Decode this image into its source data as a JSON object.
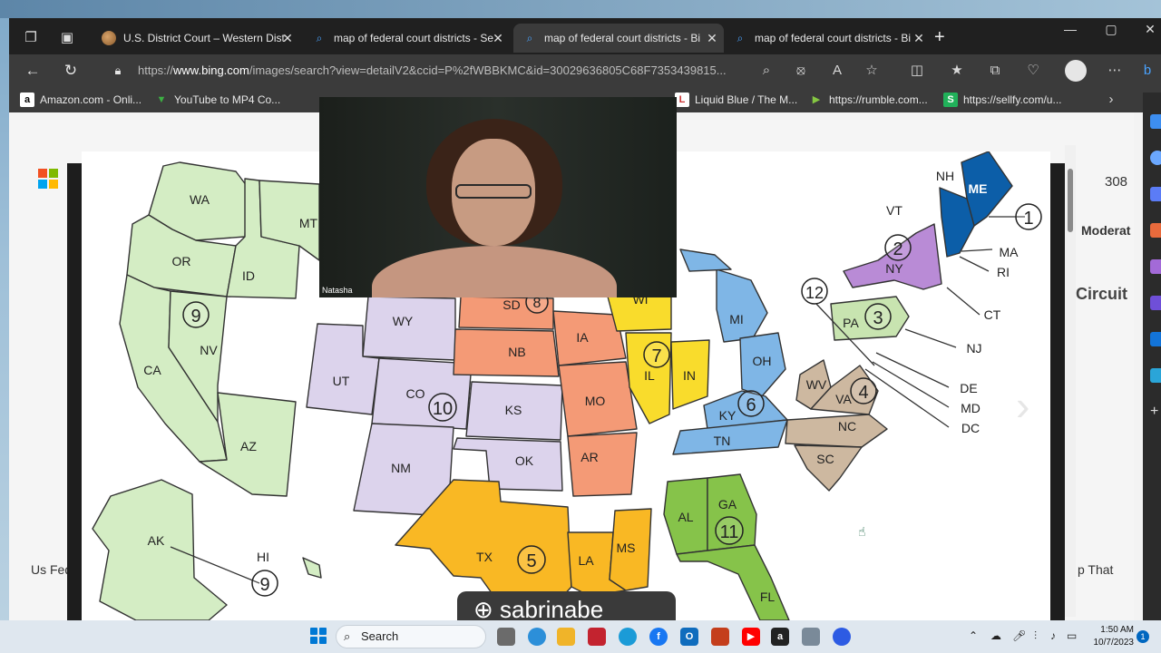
{
  "tabs": [
    {
      "title": "U.S. District Court – Western Dist",
      "active": false
    },
    {
      "title": "map of federal court districts - Se",
      "active": false
    },
    {
      "title": "map of federal court districts - Bi",
      "active": true
    },
    {
      "title": "map of federal court districts - Bi",
      "active": false
    }
  ],
  "address": {
    "prefix": "https://",
    "domain": "www.bing.com",
    "path": "/images/search?view=detailV2&ccid=P%2fWBBKMC&id=30029636805C68F7353439815..."
  },
  "bookmarks": [
    {
      "label": "Amazon.com - Onli...",
      "icon": "a",
      "color": "#ffffff"
    },
    {
      "label": "YouTube to MP4 Co...",
      "icon": "▼",
      "color": "#3cb043"
    },
    {
      "label": "https://rumble.com...",
      "icon": "▶",
      "color": "#85c742"
    },
    {
      "label": "https://sellfy.com/u...",
      "icon": "S",
      "color": "#21b15a"
    },
    {
      "label": "Liquid Blue / The M...",
      "icon": "L",
      "color": "#cc3333"
    }
  ],
  "bg_labels": {
    "count": "308",
    "tag1": "Moderat",
    "tag2": "Circuit",
    "left_caption": "Us Fed",
    "right_caption": "p That"
  },
  "map": {
    "states": [
      {
        "code": "WA"
      },
      {
        "code": "OR"
      },
      {
        "code": "ID"
      },
      {
        "code": "MT"
      },
      {
        "code": "CA"
      },
      {
        "code": "NV"
      },
      {
        "code": "AZ"
      },
      {
        "code": "AK"
      },
      {
        "code": "HI"
      },
      {
        "code": "WY"
      },
      {
        "code": "UT"
      },
      {
        "code": "CO"
      },
      {
        "code": "NM"
      },
      {
        "code": "KS"
      },
      {
        "code": "OK"
      },
      {
        "code": "SD"
      },
      {
        "code": "NB"
      },
      {
        "code": "IA"
      },
      {
        "code": "MO"
      },
      {
        "code": "AR"
      },
      {
        "code": "WI"
      },
      {
        "code": "IL"
      },
      {
        "code": "IN"
      },
      {
        "code": "MI"
      },
      {
        "code": "OH"
      },
      {
        "code": "KY"
      },
      {
        "code": "TN"
      },
      {
        "code": "TX"
      },
      {
        "code": "LA"
      },
      {
        "code": "MS"
      },
      {
        "code": "AL"
      },
      {
        "code": "GA"
      },
      {
        "code": "FL"
      },
      {
        "code": "WV"
      },
      {
        "code": "VA"
      },
      {
        "code": "NC"
      },
      {
        "code": "SC"
      },
      {
        "code": "PA"
      },
      {
        "code": "NY"
      },
      {
        "code": "VT"
      },
      {
        "code": "NH"
      },
      {
        "code": "ME"
      },
      {
        "code": "MA"
      },
      {
        "code": "RI"
      },
      {
        "code": "CT"
      },
      {
        "code": "NJ"
      },
      {
        "code": "DE"
      },
      {
        "code": "MD"
      },
      {
        "code": "DC"
      }
    ],
    "circuits": [
      "1",
      "2",
      "3",
      "4",
      "5",
      "6",
      "7",
      "8",
      "9",
      "9",
      "10",
      "11",
      "12"
    ],
    "colors": {
      "c9": "#d4edc4",
      "c10": "#dcd3ec",
      "c8": "#f49a76",
      "c7": "#f9dc2c",
      "c6": "#7fb6e6",
      "c5": "#f9b824",
      "c11": "#86c34a",
      "c4": "#cdb8a0",
      "c3": "#c8e4b0",
      "c2": "#b98bd6",
      "c1": "#0c5ea8"
    }
  },
  "webcam": {
    "name": "Natasha"
  },
  "caption": "sabrinabe",
  "taskbar": {
    "search": "Search",
    "time": "1:50 AM",
    "date": "10/7/2023",
    "notifications": "1"
  }
}
